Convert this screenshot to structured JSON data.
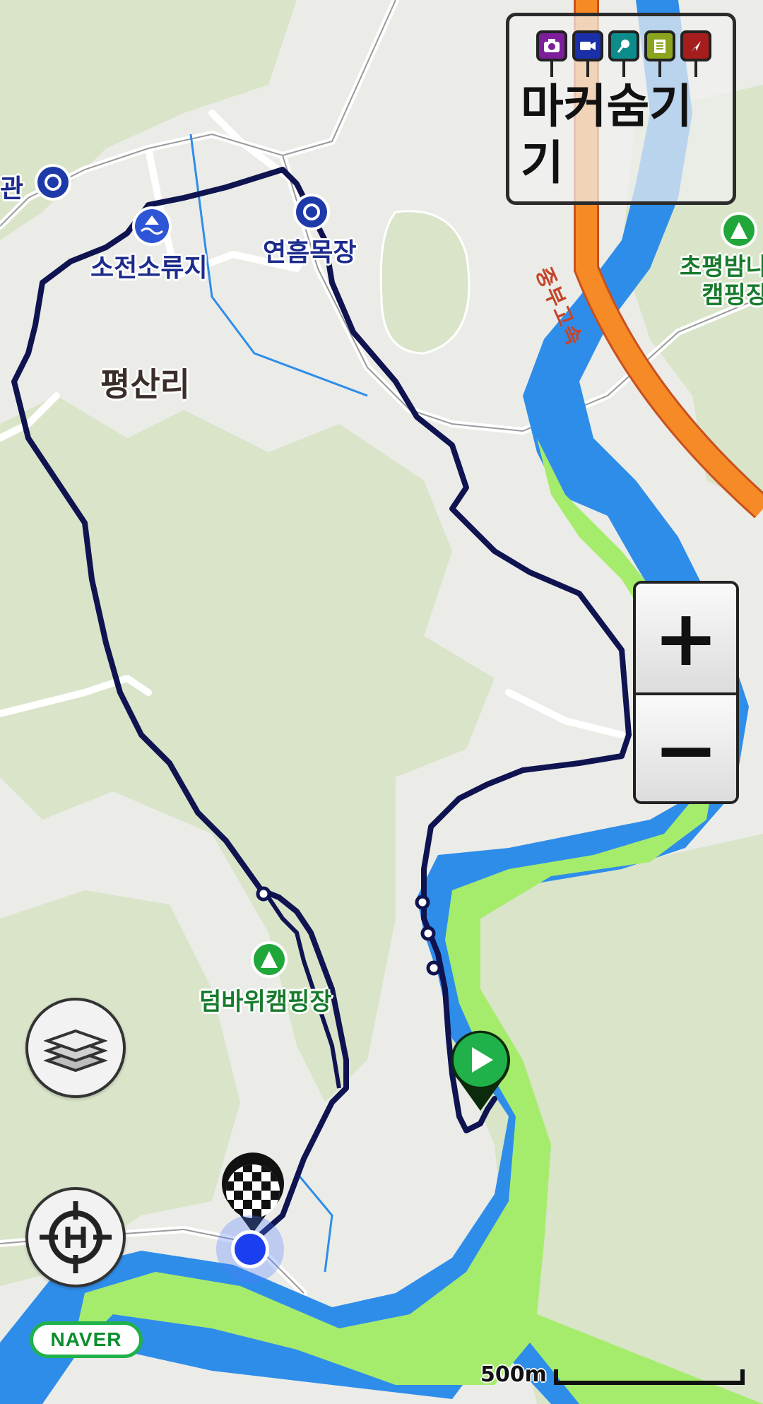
{
  "map": {
    "places": {
      "place_partial_left": "관",
      "reservoir": "소전소류지",
      "ranch": "연흠목장",
      "village": "평산리",
      "camping_right": "초평밤나\n캠핑장",
      "camping_bottom": "덤바위캠핑장"
    },
    "highway_label": "중부고속",
    "colors": {
      "track": "#0f1350",
      "river": "#2f8dea",
      "river_bank": "#a6ec6c",
      "highway": "#f58a26",
      "forest": "#d7e2c6",
      "poi_blue": "#1d2b8c",
      "poi_green": "#21a63a"
    }
  },
  "marker_panel": {
    "label": "마커숨기기",
    "pins": [
      {
        "name": "camera-icon",
        "color": "#7d1f9a"
      },
      {
        "name": "video-icon",
        "color": "#1a2fa8"
      },
      {
        "name": "microphone-icon",
        "color": "#0d8c8c"
      },
      {
        "name": "note-icon",
        "color": "#8aa51d"
      },
      {
        "name": "flag-icon",
        "color": "#a51d1d"
      }
    ]
  },
  "zoom": {
    "in_label": "+",
    "out_label": "−"
  },
  "buttons": {
    "layers": "layers-icon",
    "home": "home-target-icon"
  },
  "brand": "NAVER",
  "scale": "500m"
}
